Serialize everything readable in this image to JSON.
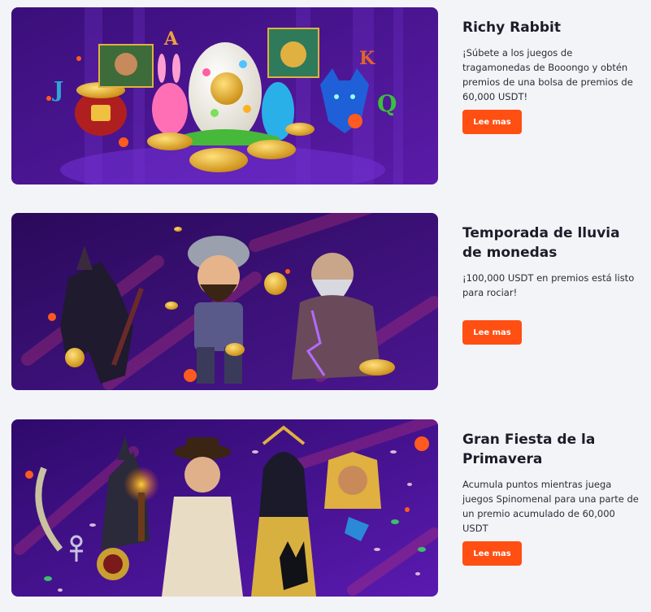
{
  "accent_color": "#ff4f12",
  "promotions": [
    {
      "title": "Richy Rabbit",
      "description": "¡Súbete a los juegos de tragamonedas de Booongo y obtén premios de una bolsa de premios de 60,000 USDT!",
      "button_label": "Lee mas",
      "banner_letters": [
        "J",
        "A",
        "K",
        "Q"
      ]
    },
    {
      "title": "Temporada de lluvia de monedas",
      "description": "¡100,000 USDT en premios está listo para rociar!",
      "button_label": "Lee mas"
    },
    {
      "title": "Gran Fiesta de la Primavera",
      "description": "Acumula puntos mientras juega juegos Spinomenal para una parte de un premio acumulado de 60,000 USDT",
      "button_label": "Lee mas"
    }
  ]
}
